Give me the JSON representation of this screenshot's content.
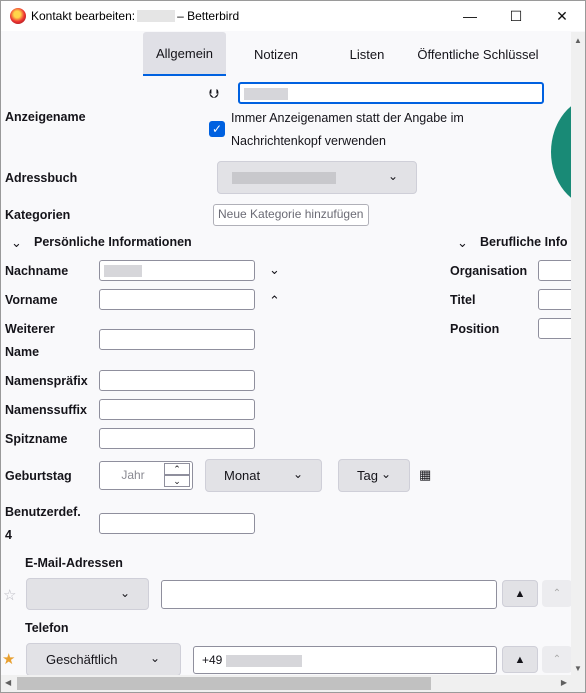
{
  "window": {
    "title_prefix": "Kontakt bearbeiten:",
    "title_suffix": "– Betterbird",
    "minimize": "—",
    "maximize": "☐",
    "close": "✕"
  },
  "tabs": [
    "Allgemein",
    "Notizen",
    "Listen",
    "Öffentliche Schlüssel"
  ],
  "display_name": {
    "label": "Anzeigename",
    "checkbox_label_line1": "Immer Anzeigenamen statt der Angabe im",
    "checkbox_label_line2": "Nachrichtenkopf verwenden",
    "checked": true
  },
  "addressbook": {
    "label": "Adressbuch"
  },
  "categories": {
    "label": "Kategorien",
    "placeholder": "Neue Kategorie hinzufügen"
  },
  "personal": {
    "section_title": "Persönliche Informationen",
    "lastname_label": "Nachname",
    "firstname_label": "Vorname",
    "middlename_label_1": "Weiterer",
    "middlename_label_2": "Name",
    "prefix_label": "Namenspräfix",
    "suffix_label": "Namenssuffix",
    "nickname_label": "Spitzname",
    "birthday_label": "Geburtstag",
    "year_placeholder": "Jahr",
    "month_label": "Monat",
    "day_label": "Tag",
    "custom_label_1": "Benutzerdef.",
    "custom_label_2": "4"
  },
  "business": {
    "section_title": "Berufliche Info",
    "org_label": "Organisation",
    "title_label": "Titel",
    "position_label": "Position"
  },
  "email": {
    "section_title": "E-Mail-Adressen"
  },
  "phone": {
    "section_title": "Telefon",
    "type_label": "Geschäftlich",
    "number_prefix": "+49"
  },
  "colors": {
    "accent": "#0061e0",
    "avatar": "#198a76",
    "star": "#e8a030"
  }
}
